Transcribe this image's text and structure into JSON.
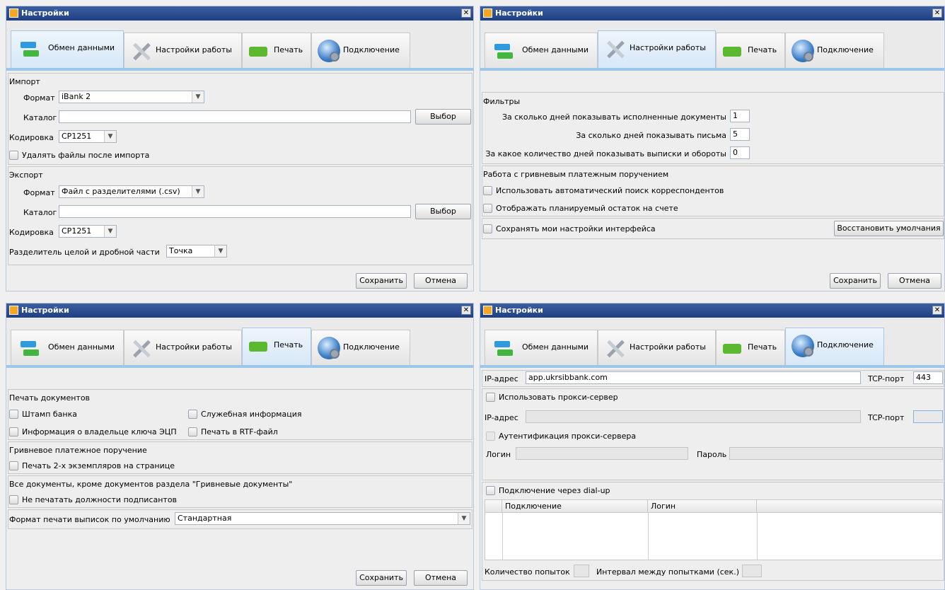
{
  "window_title": "Настройки",
  "close_glyph": "✕",
  "tabs": {
    "exchange": "Обмен данными",
    "work": "Настройки работы",
    "print": "Печать",
    "connection": "Подключение"
  },
  "buttons": {
    "save": "Сохранить",
    "cancel": "Отмена",
    "browse": "Выбор",
    "restore_defaults": "Восстановить умолчания"
  },
  "exchange": {
    "import_title": "Импорт",
    "format_label": "Формат",
    "import_format": "iBank 2",
    "catalog_label": "Каталог",
    "import_catalog": "",
    "encoding_label": "Кодировка",
    "import_encoding": "CP1251",
    "delete_files_label": "Удалять файлы после импорта",
    "export_title": "Экспорт",
    "export_format": "Файл с разделителями (.csv)",
    "export_catalog": "",
    "export_encoding": "CP1251",
    "separator_label": "Разделитель целой и дробной части",
    "separator_value": "Точка"
  },
  "work": {
    "filters_title": "Фильтры",
    "executed_days_label": "За сколько дней показывать исполненные документы",
    "executed_days": "1",
    "letters_days_label": "За сколько дней показывать письма",
    "letters_days": "5",
    "statements_days_label": "За какое количество дней показывать выписки и обороты",
    "statements_days": "0",
    "hryvnia_title": "Работа с гривневым платежным поручением",
    "auto_search_label": "Использовать автоматический поиск корреспондентов",
    "planned_balance_label": "Отображать планируемый остаток на счете",
    "save_ui_label": "Сохранять мои настройки интерфейса"
  },
  "print": {
    "docs_title": "Печать документов",
    "bank_stamp_label": "Штамп банка",
    "service_info_label": "Служебная информация",
    "key_owner_label": "Информация о владельце ключа ЭЦП",
    "rtf_label": "Печать в RTF-файл",
    "hryvnia_order_title": "Гривневое платежное поручение",
    "two_copies_label": "Печать 2-х экземпляров на странице",
    "all_docs_title": "Все документы, кроме документов раздела \"Гривневые документы\"",
    "no_positions_label": "Не печатать должности подписантов",
    "statement_format_label": "Формат печати выписок по умолчанию",
    "statement_format_value": "Стандартная"
  },
  "connection": {
    "ip_label": "IP-адрес",
    "ip_value": "app.ukrsibbank.com",
    "tcp_label": "TCP-порт",
    "tcp_value": "443",
    "use_proxy_label": "Использовать прокси-сервер",
    "proxy_ip_value": "",
    "proxy_port_value": "",
    "proxy_auth_label": "Аутентификация прокси-сервера",
    "login_label": "Логин",
    "password_label": "Пароль",
    "dialup_label": "Подключение через dial-up",
    "table_headers": [
      "Подключение",
      "Логин"
    ],
    "attempts_label": "Количество попыток",
    "interval_label": "Интервал между попытками (сек.)"
  }
}
